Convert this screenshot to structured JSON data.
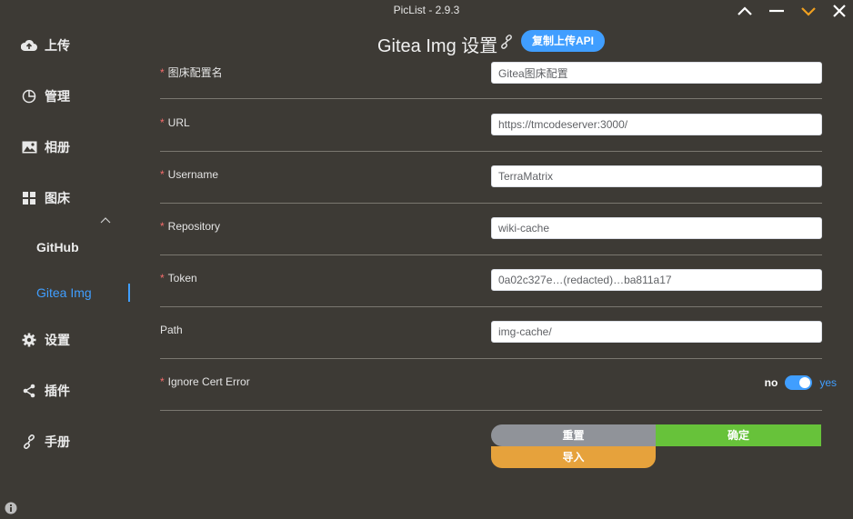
{
  "window": {
    "title": "PicList - 2.9.3",
    "controls": [
      "chevron-up-icon",
      "minimize-icon",
      "chevron-down-icon",
      "close-icon"
    ],
    "accent_color": "#f0a020"
  },
  "sidebar": {
    "items": [
      {
        "icon": "upload-icon",
        "label": "上传"
      },
      {
        "icon": "pie-chart-icon",
        "label": "管理"
      },
      {
        "icon": "image-icon",
        "label": "相册"
      },
      {
        "icon": "grid-icon",
        "label": "图床"
      },
      {
        "icon": "gear-icon",
        "label": "设置"
      },
      {
        "icon": "share-icon",
        "label": "插件"
      },
      {
        "icon": "link-icon",
        "label": "手册"
      }
    ],
    "sub_items": [
      "GitHub",
      "Gitea Img"
    ],
    "active_sub_item": "Gitea Img"
  },
  "header": {
    "title": "Gitea Img 设置",
    "api_button": "复制上传API"
  },
  "form": {
    "fields": [
      {
        "label": "图床配置名",
        "required": true,
        "value": "Gitea图床配置"
      },
      {
        "label": "URL",
        "required": true,
        "value": "https://tmcodeserver:3000/"
      },
      {
        "label": "Username",
        "required": true,
        "value": "TerraMatrix"
      },
      {
        "label": "Repository",
        "required": true,
        "value": "wiki-cache"
      },
      {
        "label": "Token",
        "required": true,
        "value": "0a02c327e…(redacted)…ba811a17"
      },
      {
        "label": "Path",
        "required": false,
        "value": "img-cache/"
      }
    ],
    "ignore_cert": {
      "label": "Ignore Cert Error",
      "required": true,
      "off_text": "no",
      "on_text": "yes",
      "value": true
    }
  },
  "buttons": {
    "reset": "重置",
    "confirm": "确定",
    "import": "导入"
  },
  "colors": {
    "background": "#3d3a35",
    "primary": "#409eff",
    "success": "#67c23a",
    "warning": "#e6a23c",
    "info": "#909399",
    "required": "#f56c6c"
  }
}
